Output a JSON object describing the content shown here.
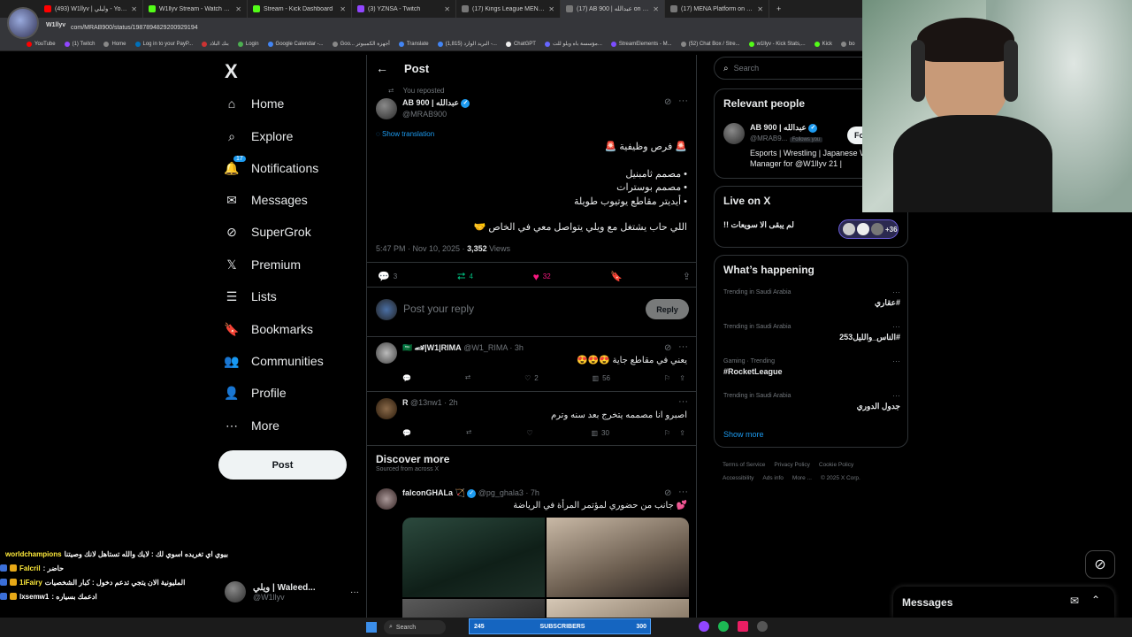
{
  "browser": {
    "tabs": [
      {
        "title": "(493) W1llyv | وليلي - YouTube",
        "color": "#ff0000"
      },
      {
        "title": "W1llyv Stream - Watch Live on Kick",
        "color": "#53fc18"
      },
      {
        "title": "Stream - Kick Dashboard",
        "color": "#53fc18"
      },
      {
        "title": "(3) YZNSA - Twitch",
        "color": "#9146ff"
      },
      {
        "title": "(17) Kings League MENA on X",
        "color": "#777777"
      },
      {
        "title": "(17) AB 900 | عبدالله on X: \"🚨",
        "color": "#777777",
        "active": true
      },
      {
        "title": "(17) MENA Platform on X: \"🚨",
        "color": "#777777"
      }
    ],
    "new_tab": "+",
    "url_label": "W1llyv",
    "url": "com/MRAB900/status/1987894829200929194",
    "bookmarks": [
      "YouTube",
      "(1) Twitch",
      "Home",
      "Log in to your PayP...",
      "بنك البلاد",
      "Login",
      "Google Calendar -...",
      "Goo... أجهزة الكمبيوتر",
      "Translate",
      "البريد الوارد (1,815) -...",
      "ChatGPT",
      "مؤسسة باه ويلو للت...",
      "StreamElements - M...",
      "(52) Chat Box / Stre...",
      "w1llyv - Kick Stats,...",
      "Kick",
      "bo"
    ]
  },
  "nav": {
    "logo": "X",
    "items": [
      {
        "label": "Home",
        "icon": "home-icon",
        "glyph": "⌂"
      },
      {
        "label": "Explore",
        "icon": "search-icon",
        "glyph": "⌕"
      },
      {
        "label": "Notifications",
        "icon": "bell-icon",
        "glyph": "🔔",
        "badge": "17"
      },
      {
        "label": "Messages",
        "icon": "envelope-icon",
        "glyph": "✉"
      },
      {
        "label": "SuperGrok",
        "icon": "grok-icon",
        "glyph": "⊘"
      },
      {
        "label": "Premium",
        "icon": "x-icon",
        "glyph": "𝕏"
      },
      {
        "label": "Lists",
        "icon": "list-icon",
        "glyph": "☰"
      },
      {
        "label": "Bookmarks",
        "icon": "bookmark-icon",
        "glyph": "🔖"
      },
      {
        "label": "Communities",
        "icon": "people-icon",
        "glyph": "👥"
      },
      {
        "label": "Profile",
        "icon": "person-icon",
        "glyph": "👤"
      },
      {
        "label": "More",
        "icon": "more-circle-icon",
        "glyph": "⋯"
      }
    ],
    "post_button": "Post",
    "account": {
      "name": "ويلي | Waleed...",
      "handle": "@W1llyv",
      "more": "···"
    }
  },
  "post_page": {
    "header_title": "Post",
    "reposted": "You reposted",
    "author": {
      "name": "AB 900 | عبدالله",
      "handle": "@MRAB900"
    },
    "show_translation": "Show translation",
    "lines": [
      "🚨 فرص وظيفية 🚨",
      "• مصمم ثامبنيل",
      "• مصمم بوسترات",
      "• أيديتر مقاطع يوتيوب طويلة",
      "اللي حاب يشتغل مع ويلي يتواصل معي في الخاص 🤝"
    ],
    "timestamp": "5:47 PM · Nov 10, 2025 · ",
    "views_count": "3,352",
    "views_label": " Views",
    "stats": {
      "replies": "3",
      "reposts": "4",
      "likes": "32"
    },
    "reply_placeholder": "Post your reply",
    "reply_button": "Reply",
    "replies": [
      {
        "name": "🇸🇦 🏎|W1|RIMA",
        "handle": "@W1_RIMA · 3h",
        "text": "يعني في مقاطع جاية 😍😍😍",
        "likes": "2",
        "views": "56"
      },
      {
        "name": "R",
        "handle": "@13nw1 · 2h",
        "text": "اصبرو انا مصممه يتخرج بعد سنه وترم",
        "likes": "",
        "views": "30"
      }
    ],
    "discover_title": "Discover more",
    "discover_sub": "Sourced from across X",
    "discover_post": {
      "name": "falconGHALa 🏹",
      "handle": "@pg_ghala3 · 7h",
      "text": "💕 جانب من حضوري لمؤتمر المرأة في الرياضة"
    }
  },
  "right": {
    "search_placeholder": "Search",
    "relevant": {
      "title": "Relevant people",
      "name": "AB 900 | عبدالله",
      "handle": "@MRAB9...",
      "follows_you": "Follows you",
      "follow_button": "Fo",
      "bio": "Esports | Wrestling | Japanese W1 Manager for @W1llyv 21 |"
    },
    "live": {
      "title": "Live on X",
      "text": "!! لم يبقى الا سويعات",
      "count": "+36"
    },
    "happening": {
      "title": "What’s happening",
      "trends": [
        {
          "category": "Trending in Saudi Arabia",
          "name": "#عقاري"
        },
        {
          "category": "Trending in Saudi Arabia",
          "name": "#الناس_والليل253"
        },
        {
          "category": "Gaming · Trending",
          "name": "#RocketLeague"
        },
        {
          "category": "Trending in Saudi Arabia",
          "name": "جدول الدوري"
        }
      ],
      "show_more": "Show more"
    },
    "footer": [
      "Terms of Service",
      "Privacy Policy",
      "Cookie Policy",
      "Accessibility",
      "Ads info",
      "More ...",
      "© 2025 X Corp."
    ]
  },
  "messages_dock": {
    "title": "Messages"
  },
  "stream": {
    "chat": [
      {
        "user": "worldchampions",
        "text": "بيوي اي تغريده اسوي لك : لايك والله تستاهل لانك وصيتنا"
      },
      {
        "user": "Falcril",
        "text": "حاضر :"
      },
      {
        "user": "1iFairy",
        "text": "المليونية الان يتجي تدعم دخول : كبار الشخصيات"
      },
      {
        "user": "lxsemw1",
        "text": "ادعمك بسياره :"
      }
    ],
    "subs_count": "245",
    "subs_label": "SUBSCRIBERS",
    "subs_goal": "300",
    "taskbar_search": "Search"
  },
  "colors": {
    "accent": "#1d9bf0",
    "repost": "#00ba7c",
    "like": "#f91880",
    "bg": "#000000",
    "border": "#2f3336"
  }
}
